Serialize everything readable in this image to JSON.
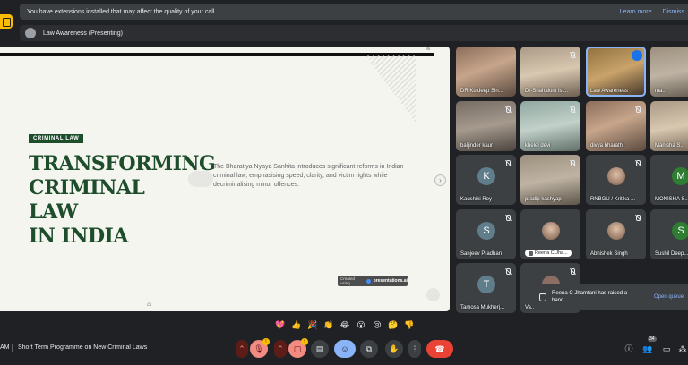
{
  "banner": {
    "message": "You have extensions installed that may affect the quality of your call",
    "learn_more": "Learn more",
    "dismiss": "Dismiss"
  },
  "presenting": {
    "label": "Law Awareness (Presenting)"
  },
  "slide": {
    "percent": "%",
    "badge": "CRIMINAL LAW",
    "title_lines": [
      "TRANSFORMING",
      "CRIMINAL LAW",
      "IN INDIA"
    ],
    "description": "The Bharatiya Nyaya Sanhita introduces significant reforms in Indian criminal law, emphasising speed, clarity, and victim rights while decriminalising minor offences.",
    "credit_prefix": "Created using",
    "credit_brand": "presentations.ai"
  },
  "participants": [
    {
      "name": "DR Kuldeep Sin...",
      "kind": "video",
      "muted": false
    },
    {
      "name": "Dr-Shahalom Isl...",
      "kind": "video",
      "muted": true
    },
    {
      "name": "Law Awareness",
      "kind": "video",
      "muted": false,
      "active": true
    },
    {
      "name": "ma...",
      "kind": "video",
      "muted": false
    },
    {
      "name": "baljinder kaur",
      "kind": "video",
      "muted": true
    },
    {
      "name": "khelei devi",
      "kind": "video",
      "muted": true
    },
    {
      "name": "divya bharathi",
      "kind": "video",
      "muted": true
    },
    {
      "name": "Manisha S...",
      "kind": "video",
      "muted": true
    },
    {
      "name": "Kaushiki Roy",
      "kind": "avatar",
      "initial": "K",
      "muted": true
    },
    {
      "name": "pradip kashyap",
      "kind": "video",
      "muted": true
    },
    {
      "name": "RNBGU / Kritika ...",
      "kind": "photo",
      "muted": true
    },
    {
      "name": "MONISHA S...",
      "kind": "avatar",
      "initial": "M",
      "muted": true
    },
    {
      "name": "Sanjeev Pradhan",
      "kind": "avatar",
      "initial": "S",
      "muted": true
    },
    {
      "name": "Reena C Jha...",
      "kind": "photo",
      "muted": false,
      "hand": true
    },
    {
      "name": "Abhishek Singh",
      "kind": "photo",
      "muted": true
    },
    {
      "name": "Sushil Deep...",
      "kind": "avatar",
      "initial": "S",
      "muted": true
    },
    {
      "name": "Tamosa Mukherj...",
      "kind": "avatar",
      "initial": "T",
      "muted": true
    },
    {
      "name": "Va...",
      "kind": "avatar",
      "initial": "",
      "muted": true
    }
  ],
  "toast": {
    "message": "Reena C Jhamtani has raised a hand",
    "action": "Open queue"
  },
  "reactions": [
    "💖",
    "👍",
    "🎉",
    "👏",
    "😂",
    "😮",
    "😢",
    "🤔",
    "👎"
  ],
  "bottom": {
    "time": "AM",
    "meeting_title": "Short Term Programme on New Criminal Laws",
    "mic_badge": "!",
    "cam_badge": "!",
    "people_count": "34"
  },
  "colors": {
    "accent": "#8ab4f8",
    "slide_green": "#1e4d2b",
    "end_call": "#ea4335"
  }
}
